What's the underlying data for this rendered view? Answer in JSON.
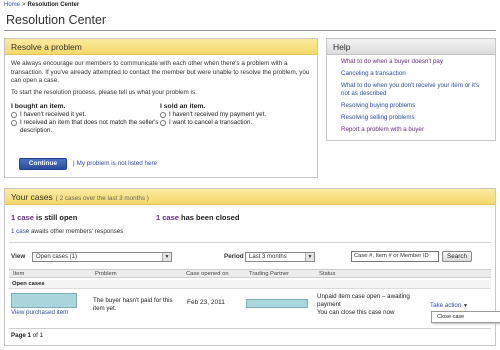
{
  "breadcrumb": {
    "home": "Home",
    "separator": ">",
    "current": "Resolution Center"
  },
  "page_title": "Resolution Center",
  "resolve": {
    "heading": "Resolve a problem",
    "intro": "We always encourage our members to communicate with each other when there's a problem with a transaction. If you've already attempted to contact the member but were unable to resolve the problem, you can open a case.",
    "prompt": "To start the resolution process, please tell us what your problem is:",
    "bought": {
      "heading": "I bought an item.",
      "options": [
        "I haven't received it yet.",
        "I received an item that does not match the seller's description."
      ]
    },
    "sold": {
      "heading": "I sold an item.",
      "options": [
        "I haven't received my payment yet.",
        "I want to cancel a transaction."
      ]
    },
    "continue_label": "Continue",
    "separator": "|",
    "not_listed_label": "My problem is not listed here"
  },
  "help": {
    "heading": "Help",
    "links": [
      "What to do when a buyer doesn't pay",
      "Canceling a transaction",
      "What to do when you don't receive your item or it's not as described",
      "Resolving buying problems",
      "Resolving selling problems",
      "Report a problem with a buyer"
    ]
  },
  "cases": {
    "heading": "Your cases",
    "count_note": "( 2 cases over the last 3 months )",
    "open_num": "1 case",
    "open_text": "is still open",
    "closed_num": "1 case",
    "closed_text": "has been closed",
    "awaits_num": "1 case",
    "awaits_text": "awaits other members' responses",
    "view_label": "View",
    "view_value": "Open cases (1)",
    "period_label": "Period",
    "period_value": "Last 3 months",
    "search_value": "Case #, Item # or Member ID",
    "search_label": "Search",
    "columns": [
      "Item",
      "Problem",
      "Case opened on",
      "Trading Partner",
      "Status"
    ],
    "group_label": "Open cases",
    "row": {
      "item_link": "View purchased item",
      "problem": "The buyer hasn't paid for this item yet.",
      "opened_on": "Feb 23, 2011",
      "status_line1": "Unpaid item case open – awaiting payment",
      "status_line2": "You can close this case now",
      "action_label": "Take action",
      "action_menu_item": "Close case"
    },
    "pager": {
      "page_word": "Page",
      "current": "1",
      "of_word": "of",
      "total": "1"
    }
  },
  "colors": {
    "link": "#2a4fa8",
    "visited": "#6b2c8a",
    "header_yellow": "#f5d96a",
    "button_blue": "#2a4c9c",
    "thumb_teal": "#a9d6dd"
  }
}
